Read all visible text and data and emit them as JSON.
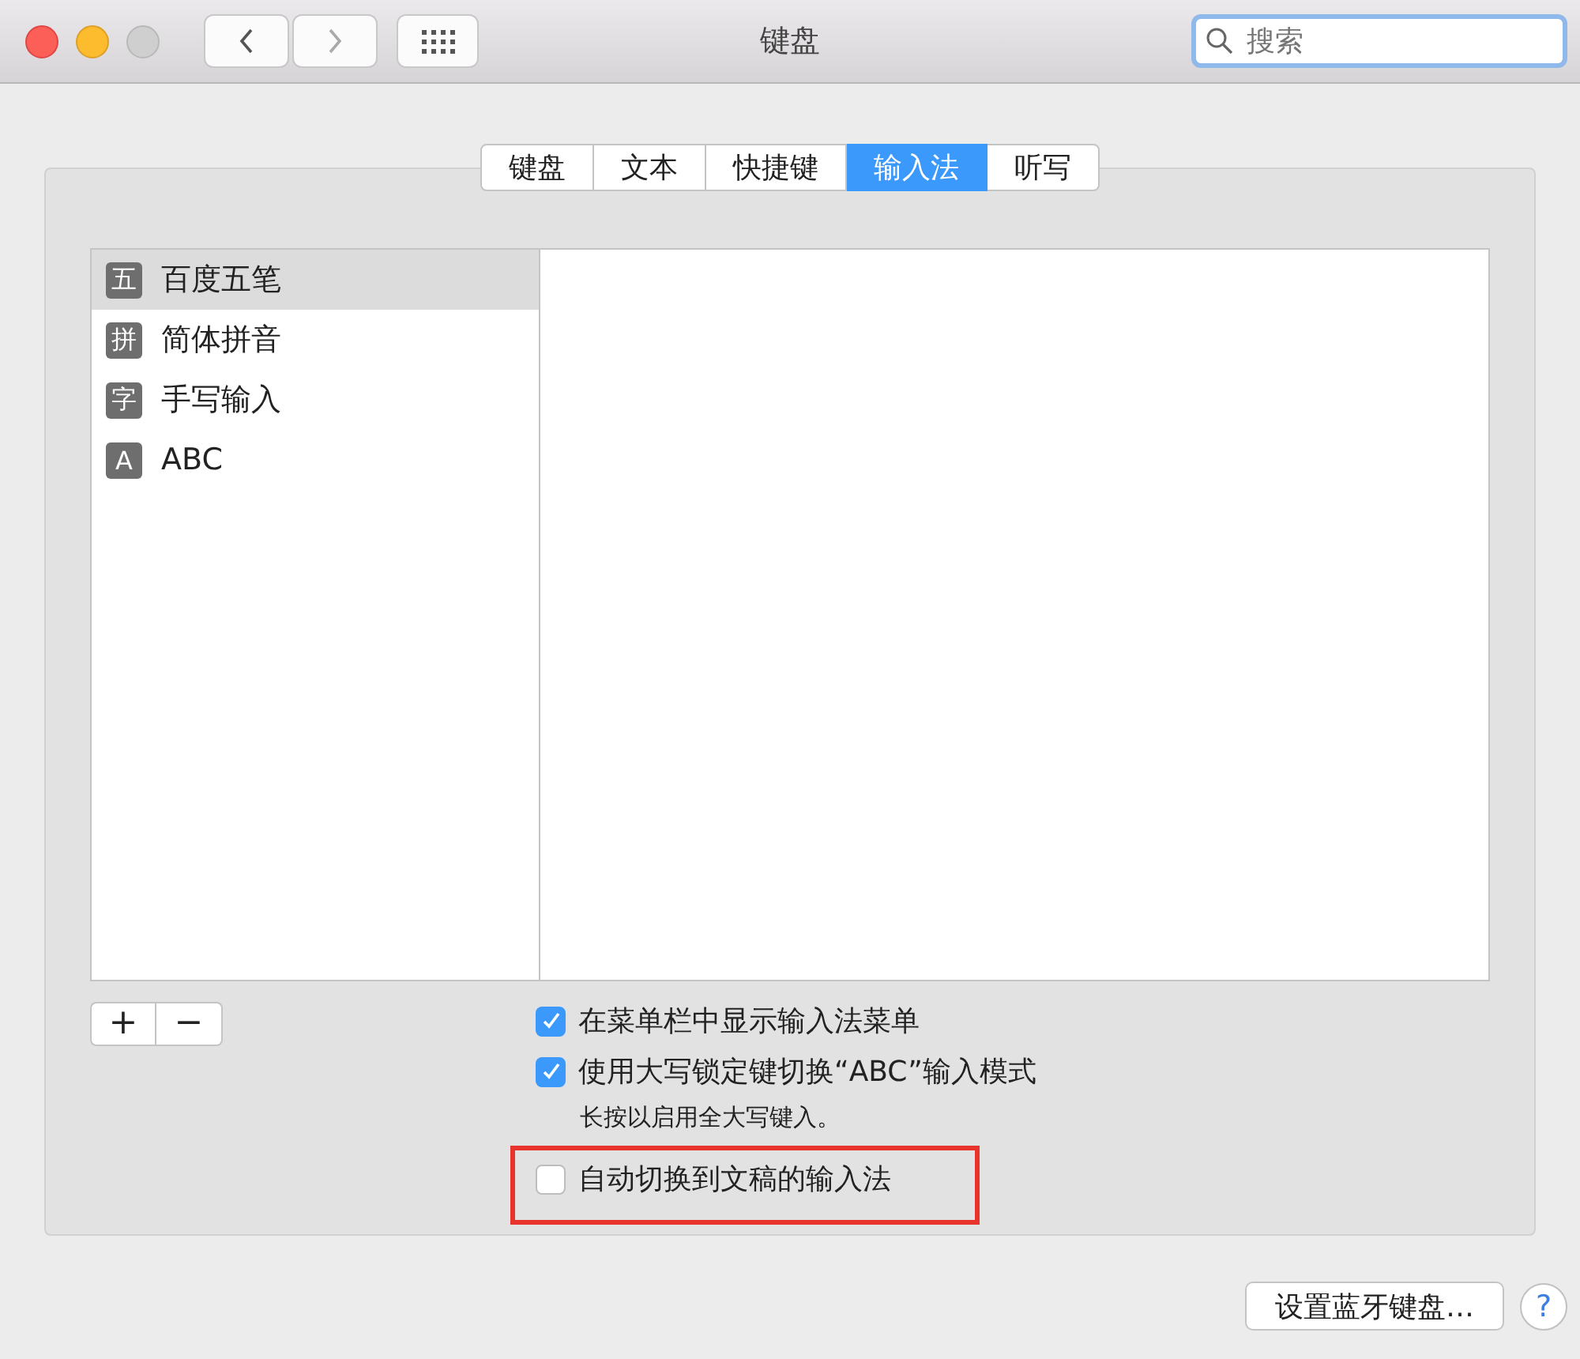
{
  "window": {
    "title": "键盘"
  },
  "search": {
    "placeholder": "搜索"
  },
  "tabs": [
    {
      "label": "键盘",
      "selected": false
    },
    {
      "label": "文本",
      "selected": false
    },
    {
      "label": "快捷键",
      "selected": false
    },
    {
      "label": "输入法",
      "selected": true
    },
    {
      "label": "听写",
      "selected": false
    }
  ],
  "input_sources": [
    {
      "badge": "五",
      "name": "百度五笔",
      "selected": true
    },
    {
      "badge": "拼",
      "name": "简体拼音",
      "selected": false
    },
    {
      "badge": "字",
      "name": "手写输入",
      "selected": false
    },
    {
      "badge": "A",
      "name": "ABC",
      "selected": false
    }
  ],
  "list_buttons": [
    "+",
    "−"
  ],
  "options": [
    {
      "label": "在菜单栏中显示输入法菜单",
      "checked": true,
      "highlighted": false
    },
    {
      "label": "使用大写锁定键切换“ABC”输入模式",
      "checked": true,
      "highlighted": false,
      "hint": "长按以启用全大写键入。"
    },
    {
      "label": "自动切换到文稿的输入法",
      "checked": false,
      "highlighted": true
    }
  ],
  "bluetooth_button": "设置蓝牙键盘…",
  "help_button": "?"
}
